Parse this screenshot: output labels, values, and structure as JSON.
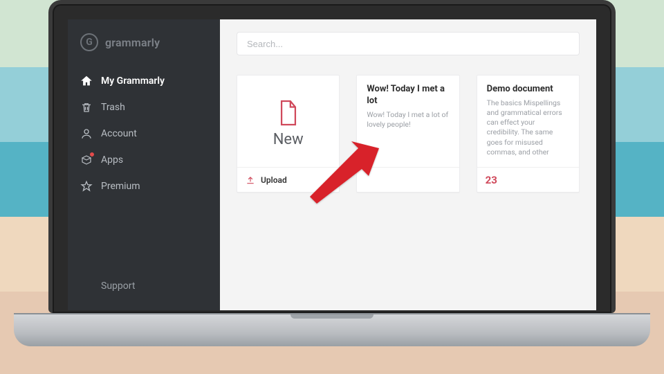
{
  "brand": {
    "name": "grammarly"
  },
  "sidebar": {
    "items": [
      {
        "icon": "home",
        "label": "My Grammarly",
        "active": true,
        "badge": false
      },
      {
        "icon": "trash",
        "label": "Trash",
        "active": false,
        "badge": false
      },
      {
        "icon": "account",
        "label": "Account",
        "active": false,
        "badge": false
      },
      {
        "icon": "apps",
        "label": "Apps",
        "active": false,
        "badge": true
      },
      {
        "icon": "star",
        "label": "Premium",
        "active": false,
        "badge": false
      }
    ],
    "support_label": "Support"
  },
  "search": {
    "placeholder": "Search..."
  },
  "new_card": {
    "label": "New",
    "upload_label": "Upload"
  },
  "documents": [
    {
      "title": "Wow! Today I met a lot",
      "snippet": "Wow! Today I met a lot of lovely people!",
      "issues": null
    },
    {
      "title": "Demo document",
      "snippet": "The basics Mispellings and grammatical errors can effect your credibility. The same goes for misused commas, and other",
      "issues": 23
    }
  ],
  "annotation": {
    "kind": "arrow",
    "target": "new-card"
  }
}
